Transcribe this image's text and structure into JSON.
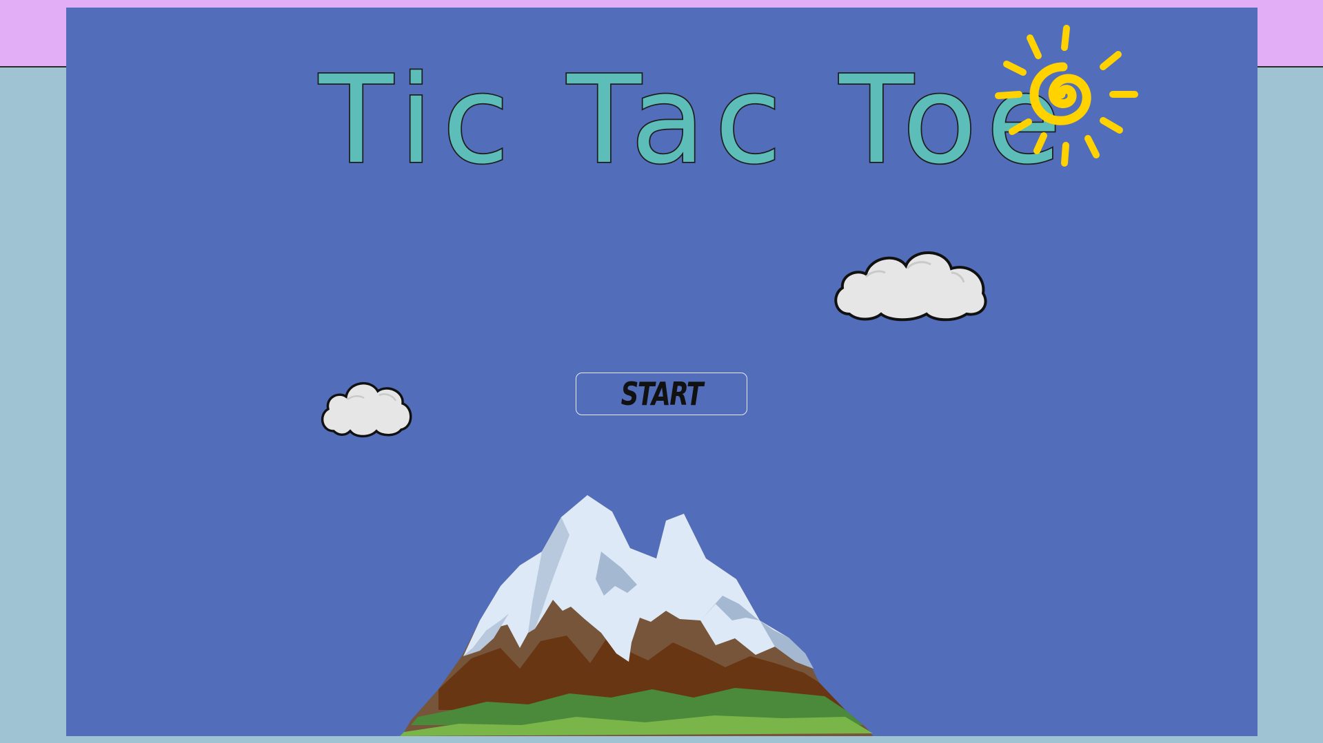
{
  "game": {
    "title": "Tic Tac Toe",
    "start_label": "START"
  },
  "colors": {
    "top_band": "#e2aef6",
    "page_background": "#a0c3d3",
    "stage_background": "#526db9",
    "title_fill": "#5cbdb9",
    "sun": "#ffd200",
    "cloud": "#e6e6e6",
    "snow": "#dde9f6",
    "rock": "#6b4423",
    "grass": "#5a9a3c"
  },
  "icons": [
    "sun-icon",
    "cloud-icon",
    "mountain-illustration"
  ]
}
